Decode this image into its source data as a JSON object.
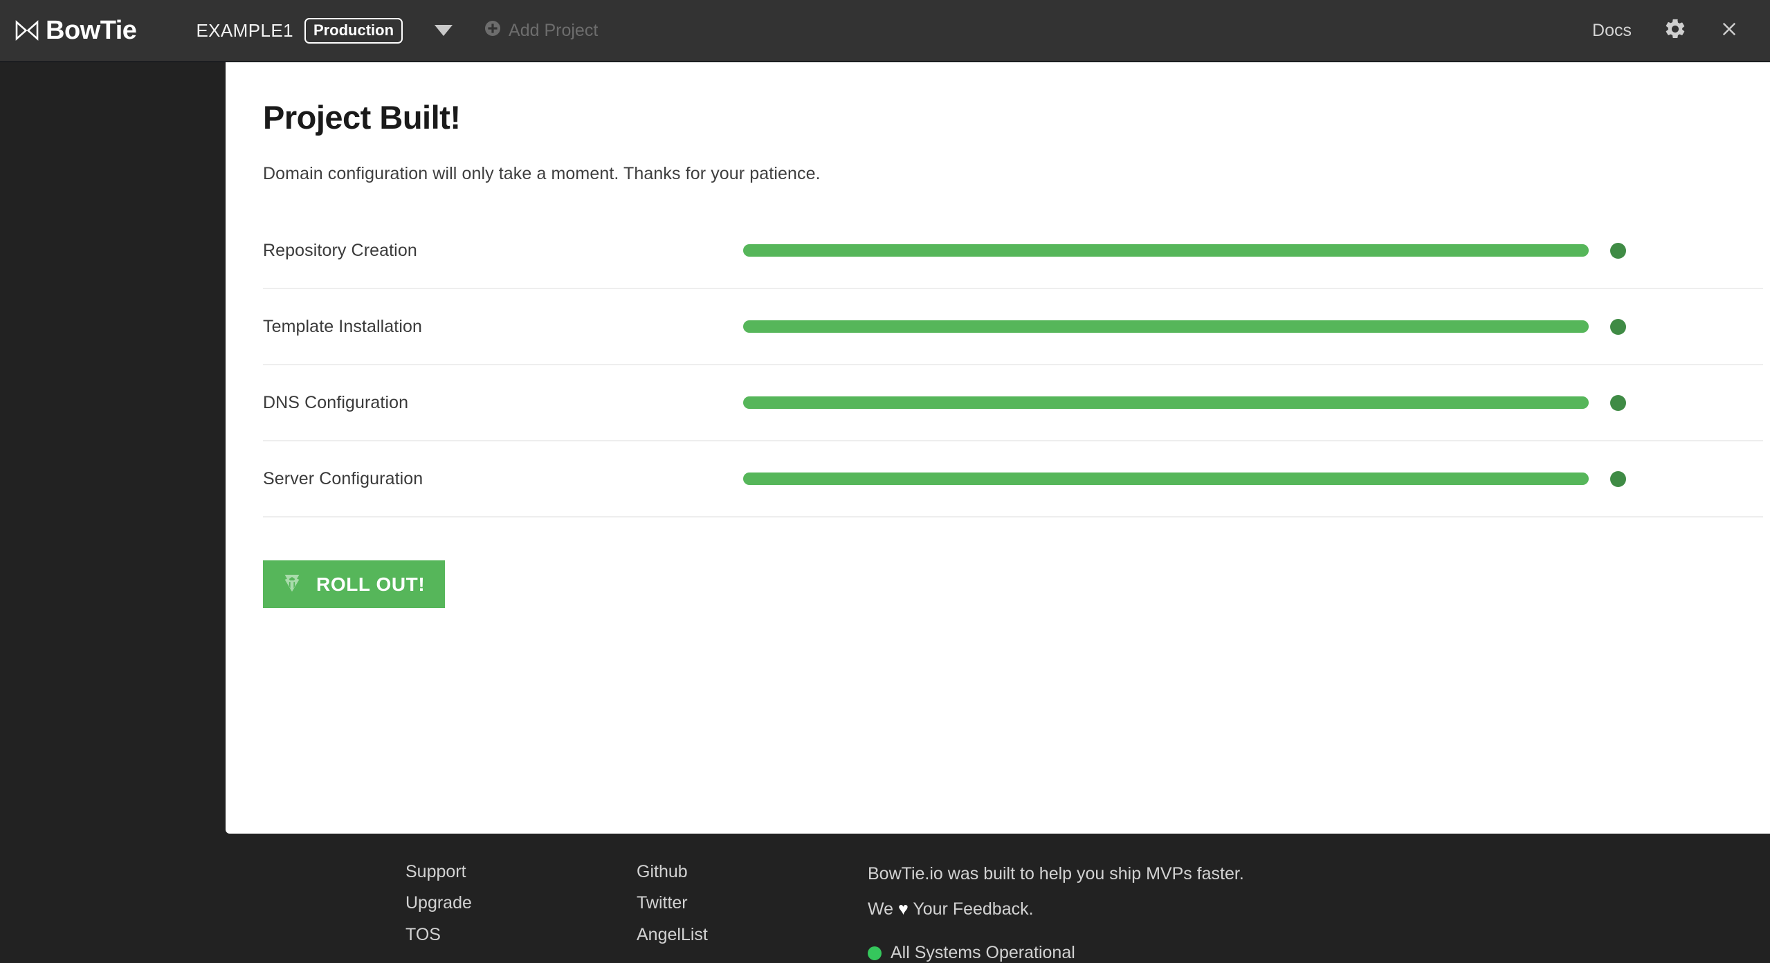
{
  "header": {
    "brand_name": "BowTie",
    "brand_icon": "bowtie-icon",
    "project_name": "EXAMPLE1",
    "env_badge": "Production",
    "project_dropdown_icon": "chevron-down-icon",
    "add_project_label": "Add Project",
    "add_project_icon": "plus-circle-icon",
    "docs_label": "Docs",
    "settings_icon": "gear-icon",
    "close_icon": "close-icon"
  },
  "main": {
    "title": "Project Built!",
    "subtitle": "Domain configuration will only take a moment. Thanks for your patience.",
    "tasks": [
      {
        "label": "Repository Creation",
        "progress": 100,
        "status": "complete"
      },
      {
        "label": "Template Installation",
        "progress": 100,
        "status": "complete"
      },
      {
        "label": "DNS Configuration",
        "progress": 100,
        "status": "complete"
      },
      {
        "label": "Server Configuration",
        "progress": 100,
        "status": "complete"
      }
    ],
    "rollout_button": {
      "label": "ROLL OUT!",
      "icon": "autobot-emblem-icon"
    }
  },
  "footer": {
    "column_one": [
      "Support",
      "Upgrade",
      "TOS"
    ],
    "column_two": [
      "Github",
      "Twitter",
      "AngelList"
    ],
    "blurb_line_one": "BowTie.io was built to help you ship MVPs faster.",
    "blurb_we": "We",
    "blurb_heart": "♥",
    "blurb_feedback": "Your Feedback.",
    "system_status": "All Systems Operational"
  },
  "colors": {
    "header_bg": "#333333",
    "page_bg": "#222222",
    "panel_bg": "#ffffff",
    "progress_green": "#56b65a",
    "status_dot_green": "#3f8b45",
    "operational_green": "#35c75c"
  }
}
